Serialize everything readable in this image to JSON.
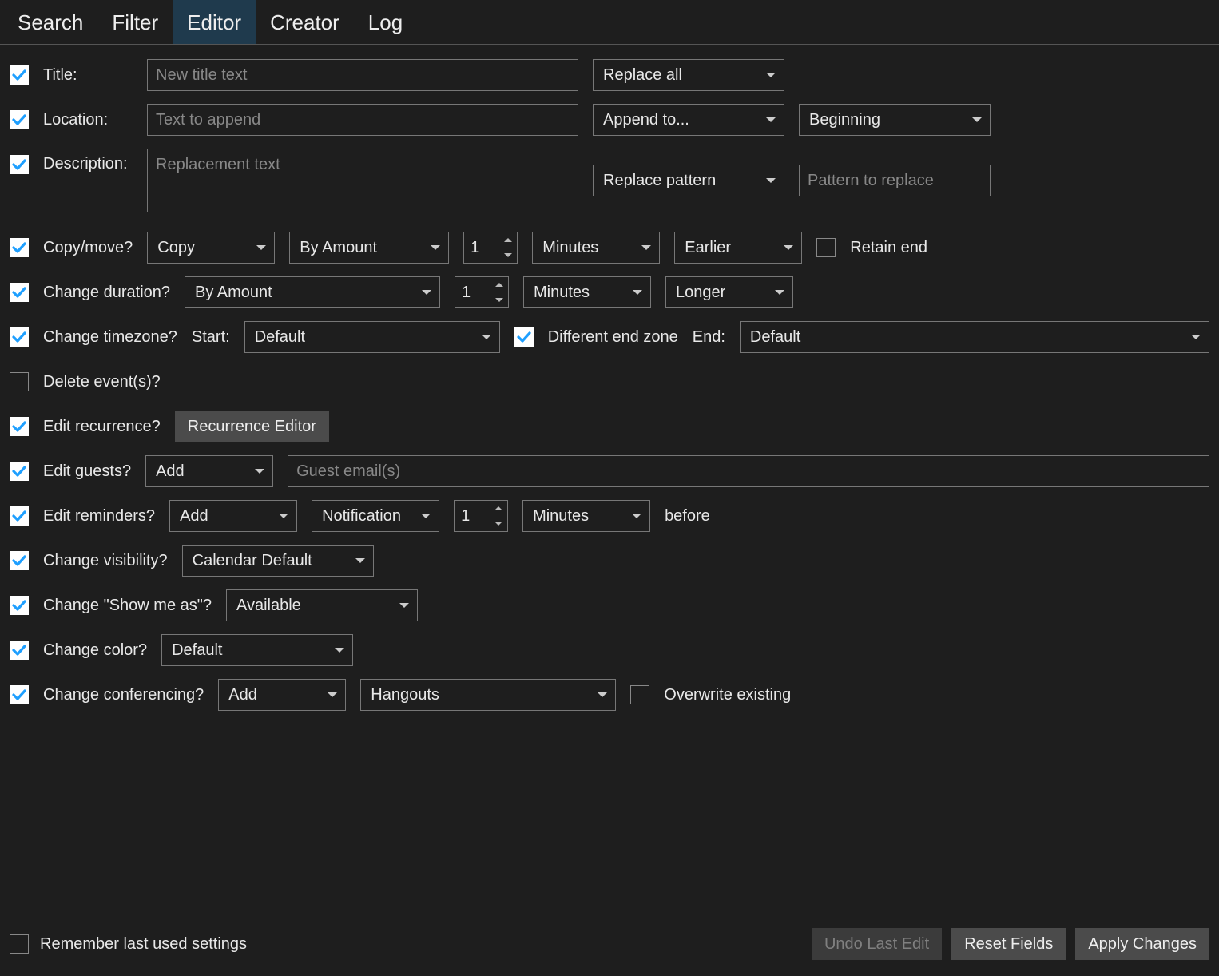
{
  "tabs": {
    "search": "Search",
    "filter": "Filter",
    "editor": "Editor",
    "creator": "Creator",
    "log": "Log",
    "active": "editor"
  },
  "title": {
    "label": "Title:",
    "placeholder": "New title text",
    "value": "",
    "mode": "Replace all"
  },
  "location": {
    "label": "Location:",
    "placeholder": "Text to append",
    "value": "",
    "mode": "Append to...",
    "position": "Beginning"
  },
  "description": {
    "label": "Description:",
    "placeholder": "Replacement text",
    "value": "",
    "mode": "Replace pattern",
    "pattern_placeholder": "Pattern to replace",
    "pattern_value": ""
  },
  "copymove": {
    "label": "Copy/move?",
    "action": "Copy",
    "by": "By Amount",
    "amount": "1",
    "unit": "Minutes",
    "direction": "Earlier",
    "retain_end_label": "Retain end",
    "retain_end_checked": false
  },
  "duration": {
    "label": "Change duration?",
    "by": "By Amount",
    "amount": "1",
    "unit": "Minutes",
    "direction": "Longer"
  },
  "timezone": {
    "label": "Change timezone?",
    "start_label": "Start:",
    "start_value": "Default",
    "diff_end_label": "Different end zone",
    "diff_end_checked": true,
    "end_label": "End:",
    "end_value": "Default"
  },
  "delete_events": {
    "label": "Delete event(s)?",
    "checked": false
  },
  "recurrence": {
    "label": "Edit recurrence?",
    "button": "Recurrence Editor"
  },
  "guests": {
    "label": "Edit guests?",
    "mode": "Add",
    "placeholder": "Guest email(s)",
    "value": ""
  },
  "reminders": {
    "label": "Edit reminders?",
    "mode": "Add",
    "type": "Notification",
    "amount": "1",
    "unit": "Minutes",
    "suffix": "before"
  },
  "visibility": {
    "label": "Change visibility?",
    "value": "Calendar Default"
  },
  "showmeas": {
    "label": "Change \"Show me as\"?",
    "value": "Available"
  },
  "color": {
    "label": "Change color?",
    "value": "Default"
  },
  "conferencing": {
    "label": "Change conferencing?",
    "mode": "Add",
    "provider": "Hangouts",
    "overwrite_label": "Overwrite existing",
    "overwrite_checked": false
  },
  "footer": {
    "remember_label": "Remember last used settings",
    "remember_checked": false,
    "undo": "Undo Last Edit",
    "reset": "Reset Fields",
    "apply": "Apply Changes"
  }
}
